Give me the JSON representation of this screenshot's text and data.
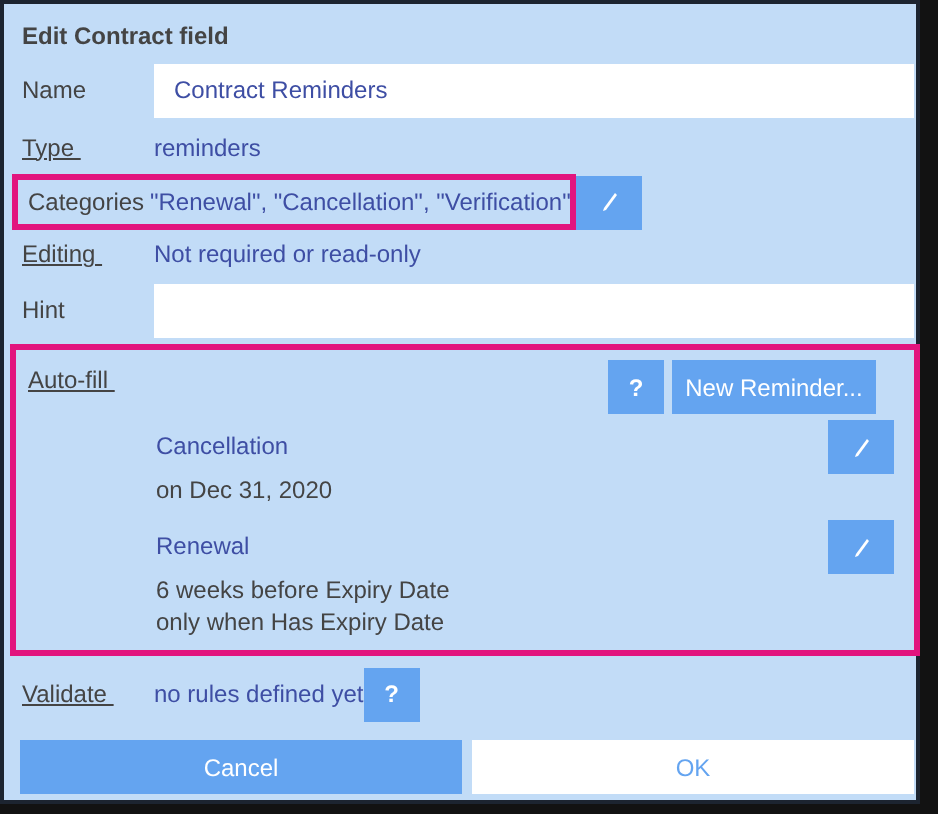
{
  "dialog": {
    "title": "Edit Contract field"
  },
  "name": {
    "label": "Name",
    "link": false,
    "value": "Contract Reminders"
  },
  "type": {
    "label": "Type ",
    "link": true,
    "value": "reminders"
  },
  "categories": {
    "label": "Categories",
    "link": false,
    "value": "\"Renewal\", \"Cancellation\", \"Verification\"",
    "highlighted": true
  },
  "editing": {
    "label": "Editing ",
    "link": true,
    "value": "Not required or read-only"
  },
  "hint": {
    "label": "Hint",
    "link": false
  },
  "auto_fill": {
    "label": "Auto-fill ",
    "link": true,
    "highlighted": true,
    "help": "?",
    "new_button": "New Reminder...",
    "reminders": [
      {
        "name": "Cancellation",
        "details": [
          "on Dec 31, 2020"
        ]
      },
      {
        "name": "Renewal",
        "details": [
          "6 weeks before Expiry Date",
          "only when Has Expiry Date"
        ]
      }
    ]
  },
  "validate": {
    "label": "Validate ",
    "link": true,
    "value": "no rules defined yet",
    "help": "?"
  },
  "buttons": [
    {
      "label": "Cancel",
      "kind": "secondary"
    },
    {
      "label": "OK",
      "kind": "primary"
    }
  ]
}
